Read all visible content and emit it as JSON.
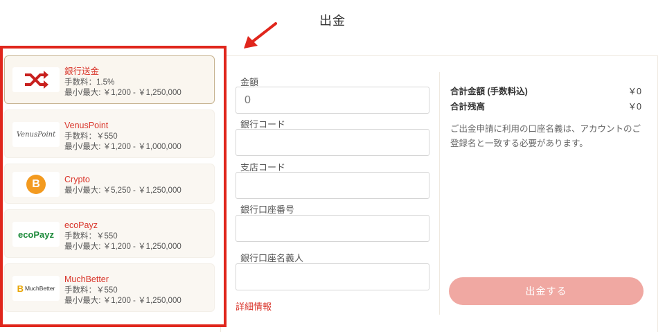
{
  "page": {
    "title": "出金"
  },
  "colors": {
    "accent": "#d9352b",
    "highlight_box": "#e0261c",
    "button": "#f0a8a2"
  },
  "methods": [
    {
      "name": "銀行送金",
      "fee": "手数料：1.5%",
      "limit": "最小/最大: ￥1,200 - ￥1,250,000",
      "icon": "shuffle-icon"
    },
    {
      "name": "VenusPoint",
      "fee": "手数料：￥550",
      "limit": "最小/最大: ￥1,200 - ￥1,000,000",
      "logo_text": "VenusPoint",
      "icon": "venuspoint-logo"
    },
    {
      "name": "Crypto",
      "fee": "最小/最大: ￥5,250 - ￥1,250,000",
      "logo_text": "B",
      "icon": "bitcoin-icon"
    },
    {
      "name": "ecoPayz",
      "fee": "手数料：￥550",
      "limit": "最小/最大: ￥1,200 - ￥1,250,000",
      "logo_text": "ecoPayz",
      "icon": "ecopayz-logo"
    },
    {
      "name": "MuchBetter",
      "fee": "手数料：￥550",
      "limit": "最小/最大: ￥1,200 - ￥1,250,000",
      "logo_text": "MuchBetter",
      "icon": "muchbetter-logo"
    }
  ],
  "form": {
    "amount_label": "金額",
    "amount_value": "0",
    "bank_code_label": "銀行コード",
    "branch_code_label": "支店コード",
    "account_number_label": "銀行口座番号",
    "account_holder_label": "銀行口座名義人",
    "details_link": "詳細情報"
  },
  "summary": {
    "total_label": "合計金額 (手数料込)",
    "total_value": "￥0",
    "balance_label": "合計残高",
    "balance_value": "￥0",
    "notice": "ご出金申請に利用の口座名義は、アカウントのご登録名と一致する必要があります。",
    "submit_label": "出金する"
  }
}
